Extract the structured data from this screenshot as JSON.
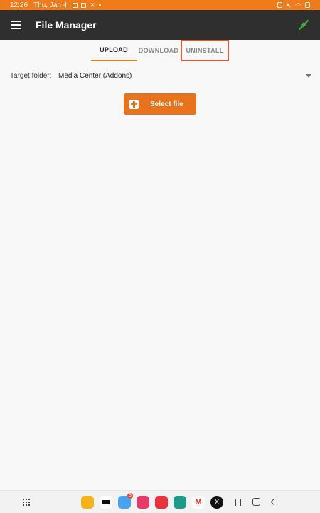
{
  "status_bar": {
    "time": "12:26",
    "date": "Thu, Jan 4"
  },
  "app_bar": {
    "title": "File Manager"
  },
  "tabs": [
    {
      "label": "UPLOAD",
      "active": true
    },
    {
      "label": "DOWNLOAD",
      "active": false
    },
    {
      "label": "UNINSTALL",
      "active": false
    }
  ],
  "target_folder": {
    "label": "Target folder:",
    "value": "Media Center (Addons)"
  },
  "select_file_button": {
    "label": "Select file"
  },
  "dock": {
    "store_badge": "5",
    "gmail_label": "M",
    "x_label": "X"
  },
  "colors": {
    "accent": "#ef7b1b",
    "appbar": "#2f2f2f",
    "highlight": "#e05a3a"
  }
}
